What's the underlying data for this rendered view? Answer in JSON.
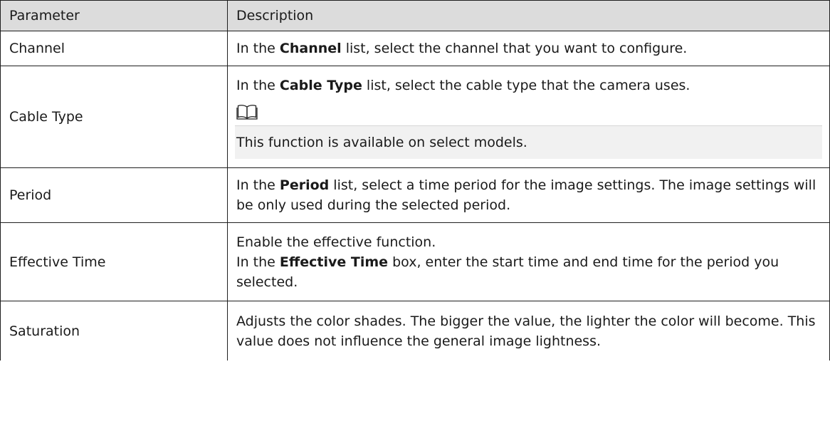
{
  "table": {
    "header": {
      "parameter": "Parameter",
      "description": "Description"
    },
    "channel": {
      "name": "Channel",
      "desc_pre": "In the ",
      "desc_kw": "Channel",
      "desc_post": "  list, select the channel that you want to configure."
    },
    "cable_type": {
      "name": "Cable Type",
      "desc_pre": "In the ",
      "desc_kw": "Cable Type",
      "desc_post": "  list, select the cable type that the camera uses.",
      "note_icon": "book-icon",
      "note_text": "This function is available on select models."
    },
    "period": {
      "name": "Period",
      "desc_pre": "In the ",
      "desc_kw": "Period",
      "desc_post": "  list, select a time period for the image settings. The image settings will be only used during the selected period."
    },
    "effective_time": {
      "name": "Effective Time",
      "line1": "Enable the effective function.",
      "desc_pre": "In the ",
      "desc_kw": "Effective Time",
      "desc_post": "  box, enter the start time and end time for the period you selected."
    },
    "saturation": {
      "name": "Saturation",
      "desc": "Adjusts the color shades. The bigger the value, the lighter the color will become. This value does not influence the general image lightness."
    }
  }
}
